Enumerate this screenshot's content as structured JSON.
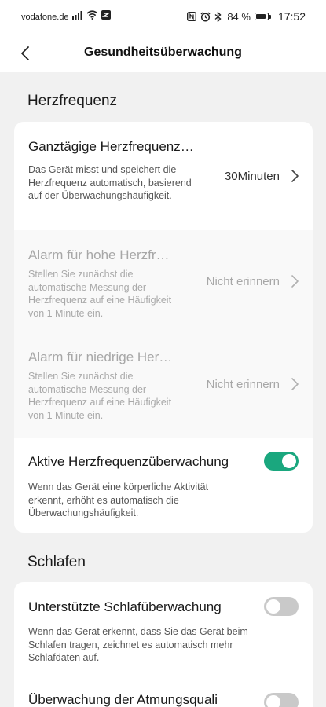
{
  "status_bar": {
    "carrier": "vodafone.de",
    "battery": "84 %",
    "battery_level": 0.84,
    "time": "17:52",
    "icons": [
      "signal-icon",
      "wifi-icon",
      "sync-icon",
      "nfc-icon",
      "alarm-icon",
      "bluetooth-icon",
      "battery-icon"
    ]
  },
  "header": {
    "title": "Gesundheitsüberwachung",
    "back_icon": "back-arrow-icon"
  },
  "sections": {
    "heart": {
      "title": "Herzfrequenz",
      "items": [
        {
          "title": "Ganztägige Herzfrequenz…",
          "description": "Das Gerät misst und speichert die Herzfrequenz automatisch, basierend auf der Überwachungshäufigkeit.",
          "value": "30Minuten"
        },
        {
          "title": "Alarm für hohe Herzfr…",
          "description": "Stellen Sie zunächst die automatische Messung der Herzfrequenz auf eine Häufigkeit von 1 Minute ein.",
          "value": "Nicht erinnern"
        },
        {
          "title": "Alarm für niedrige Her…",
          "description": "Stellen Sie zunächst die automatische Messung der Herzfrequenz auf eine Häufigkeit von 1 Minute ein.",
          "value": "Nicht erinnern"
        },
        {
          "title": "Aktive Herzfrequenzüberwachung",
          "description": "Wenn das Gerät eine körperliche Aktivität erkennt, erhöht es automatisch die Überwachungshäufigkeit.",
          "enabled": true
        }
      ]
    },
    "sleep": {
      "title": "Schlafen",
      "items": [
        {
          "title": "Unterstützte Schlafüberwachung",
          "description": "Wenn das Gerät erkennt, dass Sie das Gerät beim Schlafen tragen, zeichnet es automatisch mehr Schlafdaten auf.",
          "enabled": false
        },
        {
          "title": "Überwachung der Atmungsquali",
          "enabled": false
        }
      ]
    }
  },
  "colors": {
    "toggle_on": "#1aa77e",
    "toggle_off": "#c9c9c9",
    "background": "#f1f1f1",
    "card": "#ffffff"
  }
}
